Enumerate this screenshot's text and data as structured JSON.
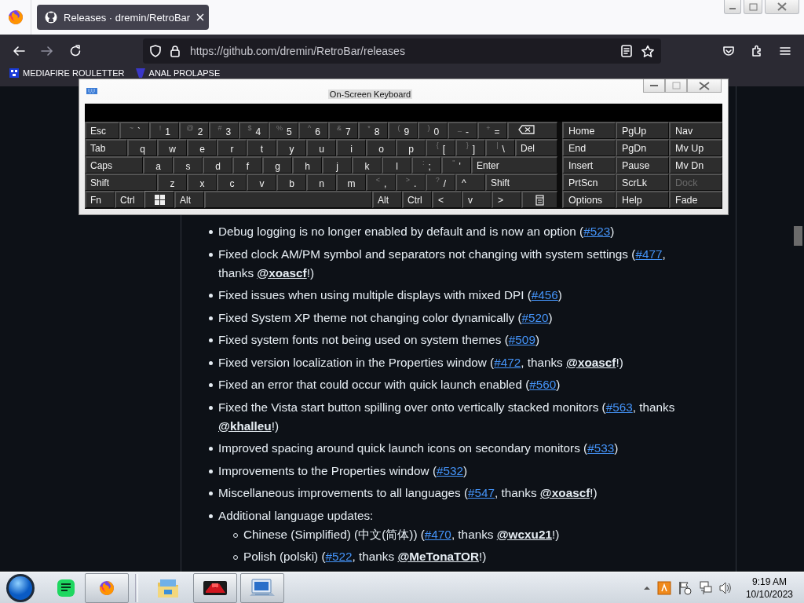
{
  "browser": {
    "tab": {
      "title": "Releases · dremin/RetroBar",
      "selected": true
    },
    "url": "https://github.com/dremin/RetroBar/releases",
    "forward_disabled": true,
    "bookmarks": [
      {
        "label": "MEDIAFIRE ROULETTER"
      },
      {
        "label": "ANAL PROLAPSE"
      }
    ]
  },
  "keyboard": {
    "title": "On-Screen Keyboard",
    "rows": [
      [
        {
          "kind": "fn",
          "label": "Esc"
        },
        {
          "kind": "char",
          "shift": "~",
          "label": "`"
        },
        {
          "kind": "char",
          "shift": "!",
          "label": "1"
        },
        {
          "kind": "char",
          "shift": "@",
          "label": "2"
        },
        {
          "kind": "char",
          "shift": "#",
          "label": "3"
        },
        {
          "kind": "char",
          "shift": "$",
          "label": "4"
        },
        {
          "kind": "char",
          "shift": "%",
          "label": "5"
        },
        {
          "kind": "char",
          "shift": "^",
          "label": "6"
        },
        {
          "kind": "char",
          "shift": "&",
          "label": "7"
        },
        {
          "kind": "char",
          "shift": "*",
          "label": "8"
        },
        {
          "kind": "char",
          "shift": "(",
          "label": "9"
        },
        {
          "kind": "char",
          "shift": ")",
          "label": "0"
        },
        {
          "kind": "char",
          "shift": "_",
          "label": "-"
        },
        {
          "kind": "char",
          "shift": "+",
          "label": "="
        },
        {
          "kind": "backspace"
        }
      ],
      [
        {
          "kind": "fn",
          "label": "Tab"
        },
        {
          "kind": "char",
          "label": "q"
        },
        {
          "kind": "char",
          "label": "w"
        },
        {
          "kind": "char",
          "label": "e"
        },
        {
          "kind": "char",
          "label": "r"
        },
        {
          "kind": "char",
          "label": "t"
        },
        {
          "kind": "char",
          "label": "y"
        },
        {
          "kind": "char",
          "label": "u"
        },
        {
          "kind": "char",
          "label": "i"
        },
        {
          "kind": "char",
          "label": "o"
        },
        {
          "kind": "char",
          "label": "p"
        },
        {
          "kind": "char",
          "shift": "{",
          "label": "["
        },
        {
          "kind": "char",
          "shift": "}",
          "label": "]"
        },
        {
          "kind": "char",
          "shift": "|",
          "label": "\\"
        },
        {
          "kind": "fn",
          "label": "Del"
        }
      ],
      [
        {
          "kind": "fn",
          "label": "Caps"
        },
        {
          "kind": "char",
          "label": "a"
        },
        {
          "kind": "char",
          "label": "s"
        },
        {
          "kind": "char",
          "label": "d"
        },
        {
          "kind": "char",
          "label": "f"
        },
        {
          "kind": "char",
          "label": "g"
        },
        {
          "kind": "char",
          "label": "h"
        },
        {
          "kind": "char",
          "label": "j"
        },
        {
          "kind": "char",
          "label": "k"
        },
        {
          "kind": "char",
          "label": "l"
        },
        {
          "kind": "char",
          "shift": ":",
          "label": ";"
        },
        {
          "kind": "char",
          "shift": "\"",
          "label": "'"
        },
        {
          "kind": "enter",
          "label": "Enter"
        }
      ],
      [
        {
          "kind": "fn",
          "label": "Shift"
        },
        {
          "kind": "char",
          "label": "z"
        },
        {
          "kind": "char",
          "label": "x"
        },
        {
          "kind": "char",
          "label": "c"
        },
        {
          "kind": "char",
          "label": "v"
        },
        {
          "kind": "char",
          "label": "b"
        },
        {
          "kind": "char",
          "label": "n"
        },
        {
          "kind": "char",
          "label": "m"
        },
        {
          "kind": "char",
          "shift": "<",
          "label": ","
        },
        {
          "kind": "char",
          "shift": ">",
          "label": "."
        },
        {
          "kind": "char",
          "shift": "?",
          "label": "/"
        },
        {
          "kind": "arrow",
          "label": "^"
        },
        {
          "kind": "fn",
          "label": "Shift"
        }
      ],
      [
        {
          "kind": "fn",
          "label": "Fn"
        },
        {
          "kind": "fn",
          "label": "Ctrl"
        },
        {
          "kind": "win"
        },
        {
          "kind": "fn",
          "label": "Alt"
        },
        {
          "kind": "space"
        },
        {
          "kind": "fn",
          "label": "Alt"
        },
        {
          "kind": "fn",
          "label": "Ctrl"
        },
        {
          "kind": "arrow",
          "label": "<"
        },
        {
          "kind": "arrow",
          "label": "v"
        },
        {
          "kind": "arrow",
          "label": ">"
        },
        {
          "kind": "menu"
        }
      ]
    ],
    "nav_keys": [
      {
        "label": "Home",
        "disabled": false
      },
      {
        "label": "PgUp",
        "disabled": false
      },
      {
        "label": "Nav",
        "disabled": false
      },
      {
        "label": "End",
        "disabled": false
      },
      {
        "label": "PgDn",
        "disabled": false
      },
      {
        "label": "Mv Up",
        "disabled": false
      },
      {
        "label": "Insert",
        "disabled": false
      },
      {
        "label": "Pause",
        "disabled": false
      },
      {
        "label": "Mv Dn",
        "disabled": false
      },
      {
        "label": "PrtScn",
        "disabled": false
      },
      {
        "label": "ScrLk",
        "disabled": false
      },
      {
        "label": "Dock",
        "disabled": true
      },
      {
        "label": "Options",
        "disabled": false
      },
      {
        "label": "Help",
        "disabled": false
      },
      {
        "label": "Fade",
        "disabled": false
      }
    ]
  },
  "release_notes": [
    {
      "parts": [
        {
          "kind": "text",
          "text": "Debug logging is no longer enabled by default and is now an option ("
        },
        {
          "kind": "issue",
          "text": "#523"
        },
        {
          "kind": "text",
          "text": ")"
        }
      ]
    },
    {
      "parts": [
        {
          "kind": "text",
          "text": "Fixed clock AM/PM symbol and separators not changing with system settings ("
        },
        {
          "kind": "issue",
          "text": "#477"
        },
        {
          "kind": "text",
          "text": ", thanks "
        },
        {
          "kind": "mention",
          "text": "@xoascf"
        },
        {
          "kind": "text",
          "text": "!)"
        }
      ]
    },
    {
      "parts": [
        {
          "kind": "text",
          "text": "Fixed issues when using multiple displays with mixed DPI ("
        },
        {
          "kind": "issue",
          "text": "#456"
        },
        {
          "kind": "text",
          "text": ")"
        }
      ]
    },
    {
      "parts": [
        {
          "kind": "text",
          "text": "Fixed System XP theme not changing color dynamically ("
        },
        {
          "kind": "issue",
          "text": "#520"
        },
        {
          "kind": "text",
          "text": ")"
        }
      ]
    },
    {
      "parts": [
        {
          "kind": "text",
          "text": "Fixed system fonts not being used on system themes ("
        },
        {
          "kind": "issue",
          "text": "#509"
        },
        {
          "kind": "text",
          "text": ")"
        }
      ]
    },
    {
      "parts": [
        {
          "kind": "text",
          "text": "Fixed version localization in the Properties window ("
        },
        {
          "kind": "issue",
          "text": "#472"
        },
        {
          "kind": "text",
          "text": ", thanks "
        },
        {
          "kind": "mention",
          "text": "@xoascf"
        },
        {
          "kind": "text",
          "text": "!)"
        }
      ]
    },
    {
      "parts": [
        {
          "kind": "text",
          "text": "Fixed an error that could occur with quick launch enabled ("
        },
        {
          "kind": "issue",
          "text": "#560"
        },
        {
          "kind": "text",
          "text": ")"
        }
      ]
    },
    {
      "parts": [
        {
          "kind": "text",
          "text": "Fixed the Vista start button spilling over onto vertically stacked monitors ("
        },
        {
          "kind": "issue",
          "text": "#563"
        },
        {
          "kind": "text",
          "text": ", thanks "
        },
        {
          "kind": "mention",
          "text": "@khalleu"
        },
        {
          "kind": "text",
          "text": "!)"
        }
      ]
    },
    {
      "parts": [
        {
          "kind": "text",
          "text": "Improved spacing around quick launch icons on secondary monitors ("
        },
        {
          "kind": "issue",
          "text": "#533"
        },
        {
          "kind": "text",
          "text": ")"
        }
      ]
    },
    {
      "parts": [
        {
          "kind": "text",
          "text": "Improvements to the Properties window ("
        },
        {
          "kind": "issue",
          "text": "#532"
        },
        {
          "kind": "text",
          "text": ")"
        }
      ]
    },
    {
      "parts": [
        {
          "kind": "text",
          "text": "Miscellaneous improvements to all languages ("
        },
        {
          "kind": "issue",
          "text": "#547"
        },
        {
          "kind": "text",
          "text": ", thanks "
        },
        {
          "kind": "mention",
          "text": "@xoascf"
        },
        {
          "kind": "text",
          "text": "!)"
        }
      ]
    },
    {
      "parts": [
        {
          "kind": "text",
          "text": "Additional language updates:"
        }
      ],
      "children": [
        {
          "parts": [
            {
              "kind": "text",
              "text": "Chinese (Simplified) (中文(简体)) ("
            },
            {
              "kind": "issue",
              "text": "#470"
            },
            {
              "kind": "text",
              "text": ", thanks "
            },
            {
              "kind": "mention",
              "text": "@wcxu21"
            },
            {
              "kind": "text",
              "text": "!)"
            }
          ]
        },
        {
          "parts": [
            {
              "kind": "text",
              "text": "Polish (polski) ("
            },
            {
              "kind": "issue",
              "text": "#522"
            },
            {
              "kind": "text",
              "text": ", thanks "
            },
            {
              "kind": "mention",
              "text": "@MeTonaTOR"
            },
            {
              "kind": "text",
              "text": "!)"
            }
          ]
        }
      ]
    }
  ],
  "taskbar": {
    "apps": [
      {
        "kind": "chat",
        "running": false
      },
      {
        "kind": "browser",
        "running": true
      },
      {
        "kind": "folder",
        "running": false
      },
      {
        "kind": "game",
        "running": true
      },
      {
        "kind": "keyboard",
        "running": true
      }
    ],
    "clock": {
      "time": "9:19 AM",
      "date": "10/10/2023"
    }
  }
}
